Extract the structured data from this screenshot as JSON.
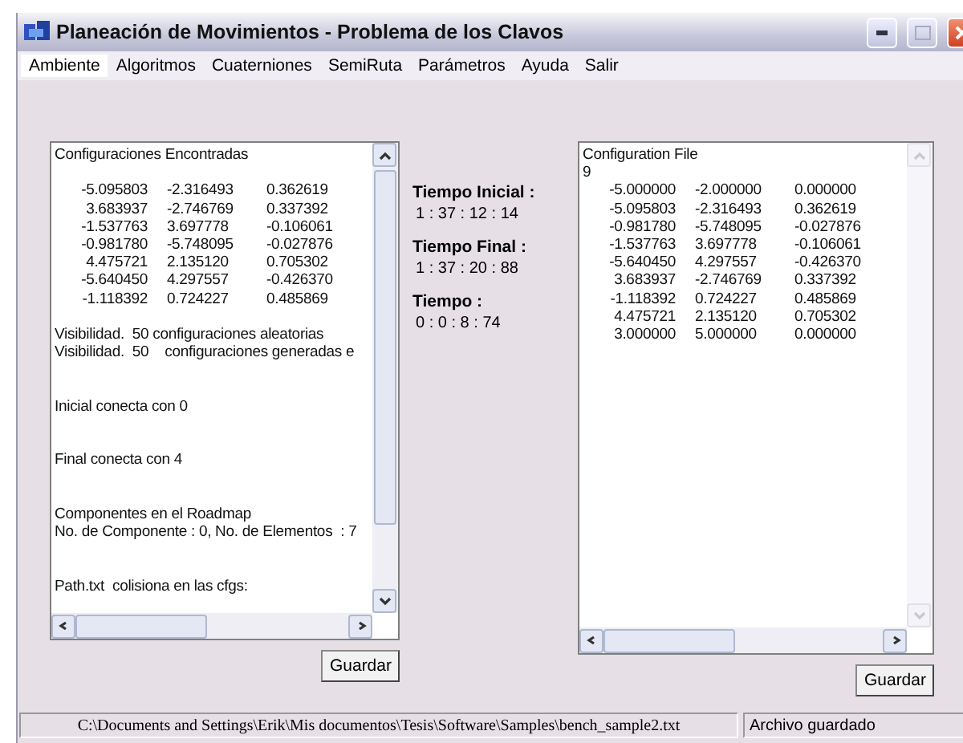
{
  "window": {
    "title": "Planeación de Movimientos - Problema de los Clavos"
  },
  "menu": [
    {
      "label": "Ambiente",
      "selected": true
    },
    {
      "label": "Algoritmos",
      "selected": false
    },
    {
      "label": "Cuaterniones",
      "selected": false
    },
    {
      "label": "SemiRuta",
      "selected": false
    },
    {
      "label": "Parámetros",
      "selected": false
    },
    {
      "label": "Ayuda",
      "selected": false
    },
    {
      "label": "Salir",
      "selected": false
    }
  ],
  "left_panel": {
    "lines": [
      {
        "kind": "text",
        "text": "Configuraciones Encontradas"
      },
      {
        "kind": "gap"
      },
      {
        "kind": "row",
        "cells": [
          "-5.095803",
          "-2.316493",
          "0.362619"
        ]
      },
      {
        "kind": "row",
        "cells": [
          "3.683937",
          "-2.746769",
          "0.337392"
        ]
      },
      {
        "kind": "row",
        "cells": [
          "-1.537763",
          "3.697778",
          "-0.106061"
        ]
      },
      {
        "kind": "row",
        "cells": [
          "-0.981780",
          "-5.748095",
          "-0.027876"
        ]
      },
      {
        "kind": "row",
        "cells": [
          "4.475721",
          "2.135120",
          "0.705302"
        ]
      },
      {
        "kind": "row",
        "cells": [
          "-5.640450",
          "4.297557",
          "-0.426370"
        ]
      },
      {
        "kind": "row",
        "cells": [
          "-1.118392",
          "0.724227",
          "0.485869"
        ]
      },
      {
        "kind": "gap"
      },
      {
        "kind": "text",
        "text": "Visibilidad.  50 configuraciones aleatorias"
      },
      {
        "kind": "text",
        "text": "Visibilidad.  50    configuraciones generadas e"
      },
      {
        "kind": "gap"
      },
      {
        "kind": "gap"
      },
      {
        "kind": "text",
        "text": "Inicial conecta con 0"
      },
      {
        "kind": "gap"
      },
      {
        "kind": "gap"
      },
      {
        "kind": "text",
        "text": "Final conecta con 4"
      },
      {
        "kind": "gap"
      },
      {
        "kind": "gap"
      },
      {
        "kind": "text",
        "text": "Componentes en el Roadmap"
      },
      {
        "kind": "text",
        "text": "No. de Componente : 0, No. de Elementos  : 7"
      },
      {
        "kind": "gap"
      },
      {
        "kind": "gap"
      },
      {
        "kind": "text",
        "text": "Path.txt  colisiona en las cfgs:"
      }
    ],
    "vscroll_disabled": false,
    "button": "Guardar"
  },
  "times": [
    {
      "label": "Tiempo Inicial :",
      "value": "1 : 37 : 12 : 14"
    },
    {
      "label": "Tiempo Final :",
      "value": "1 : 37 : 20 : 88"
    },
    {
      "label": "Tiempo :",
      "value": "0 : 0 : 8 : 74"
    }
  ],
  "right_panel": {
    "lines": [
      {
        "kind": "text",
        "text": "Configuration File"
      },
      {
        "kind": "text",
        "text": "9"
      },
      {
        "kind": "row",
        "cells": [
          "-5.000000",
          "-2.000000",
          "0.000000"
        ]
      },
      {
        "kind": "row",
        "cells": [
          "-5.095803",
          "-2.316493",
          "0.362619"
        ]
      },
      {
        "kind": "row",
        "cells": [
          "-0.981780",
          "-5.748095",
          "-0.027876"
        ]
      },
      {
        "kind": "row",
        "cells": [
          "-1.537763",
          "3.697778",
          "-0.106061"
        ]
      },
      {
        "kind": "row",
        "cells": [
          "-5.640450",
          "4.297557",
          "-0.426370"
        ]
      },
      {
        "kind": "row",
        "cells": [
          "3.683937",
          "-2.746769",
          "0.337392"
        ]
      },
      {
        "kind": "row",
        "cells": [
          "-1.118392",
          "0.724227",
          "0.485869"
        ]
      },
      {
        "kind": "row",
        "cells": [
          "4.475721",
          "2.135120",
          "0.705302"
        ]
      },
      {
        "kind": "row",
        "cells": [
          "3.000000",
          "5.000000",
          "0.000000"
        ]
      }
    ],
    "vscroll_disabled": true,
    "button": "Guardar"
  },
  "status_bar": {
    "path": "C:\\Documents and Settings\\Erik\\Mis documentos\\Tesis\\Software\\Samples\\bench_sample2.txt",
    "message": "Archivo guardado"
  }
}
